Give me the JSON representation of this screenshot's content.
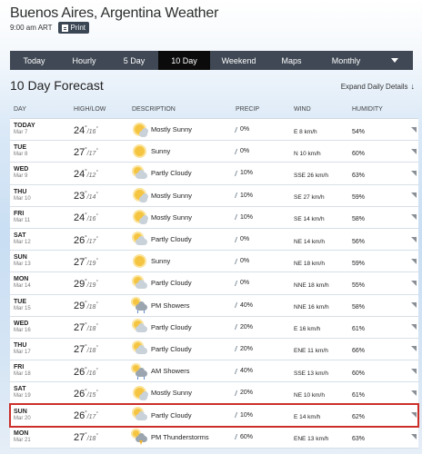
{
  "header": {
    "title": "Buenos Aires, Argentina Weather",
    "timestamp": "9:00 am ART",
    "print_label": "Print"
  },
  "tabs": [
    {
      "label": "Today"
    },
    {
      "label": "Hourly"
    },
    {
      "label": "5 Day"
    },
    {
      "label": "10 Day"
    },
    {
      "label": "Weekend"
    },
    {
      "label": "Maps"
    },
    {
      "label": "Monthly"
    }
  ],
  "section": {
    "title": "10 Day Forecast",
    "expand_label": "Expand Daily Details",
    "expand_arrow": "↓"
  },
  "columns": {
    "day": "DAY",
    "highlow": "HIGH/LOW",
    "description": "DESCRIPTION",
    "precip": "PRECIP",
    "wind": "WIND",
    "humidity": "HUMIDITY"
  },
  "rows": [
    {
      "day": "TODAY",
      "date": "Mar 7",
      "high": "24",
      "low": "16",
      "icon": "mostly-sunny",
      "desc": "Mostly Sunny",
      "precip": "0%",
      "wind": "E 8 km/h",
      "humidity": "54%"
    },
    {
      "day": "TUE",
      "date": "Mar 8",
      "high": "27",
      "low": "17",
      "icon": "sunny",
      "desc": "Sunny",
      "precip": "0%",
      "wind": "N 10 km/h",
      "humidity": "60%"
    },
    {
      "day": "WED",
      "date": "Mar 9",
      "high": "24",
      "low": "12",
      "icon": "partly-cloudy",
      "desc": "Partly Cloudy",
      "precip": "10%",
      "wind": "SSE 26 km/h",
      "humidity": "63%"
    },
    {
      "day": "THU",
      "date": "Mar 10",
      "high": "23",
      "low": "14",
      "icon": "mostly-sunny",
      "desc": "Mostly Sunny",
      "precip": "10%",
      "wind": "SE 27 km/h",
      "humidity": "59%"
    },
    {
      "day": "FRI",
      "date": "Mar 11",
      "high": "24",
      "low": "16",
      "icon": "mostly-sunny",
      "desc": "Mostly Sunny",
      "precip": "10%",
      "wind": "SE 14 km/h",
      "humidity": "58%"
    },
    {
      "day": "SAT",
      "date": "Mar 12",
      "high": "26",
      "low": "17",
      "icon": "partly-cloudy",
      "desc": "Partly Cloudy",
      "precip": "0%",
      "wind": "NE 14 km/h",
      "humidity": "56%"
    },
    {
      "day": "SUN",
      "date": "Mar 13",
      "high": "27",
      "low": "19",
      "icon": "sunny",
      "desc": "Sunny",
      "precip": "0%",
      "wind": "NE 18 km/h",
      "humidity": "59%"
    },
    {
      "day": "MON",
      "date": "Mar 14",
      "high": "29",
      "low": "19",
      "icon": "partly-cloudy",
      "desc": "Partly Cloudy",
      "precip": "0%",
      "wind": "NNE 18 km/h",
      "humidity": "55%"
    },
    {
      "day": "TUE",
      "date": "Mar 15",
      "high": "29",
      "low": "18",
      "icon": "pm-showers",
      "desc": "PM Showers",
      "precip": "40%",
      "wind": "NNE 16 km/h",
      "humidity": "58%"
    },
    {
      "day": "WED",
      "date": "Mar 16",
      "high": "27",
      "low": "18",
      "icon": "partly-cloudy",
      "desc": "Partly Cloudy",
      "precip": "20%",
      "wind": "E 16 km/h",
      "humidity": "61%"
    },
    {
      "day": "THU",
      "date": "Mar 17",
      "high": "27",
      "low": "18",
      "icon": "partly-cloudy",
      "desc": "Partly Cloudy",
      "precip": "20%",
      "wind": "ENE 11 km/h",
      "humidity": "66%"
    },
    {
      "day": "FRI",
      "date": "Mar 18",
      "high": "26",
      "low": "16",
      "icon": "am-showers",
      "desc": "AM Showers",
      "precip": "40%",
      "wind": "SSE 13 km/h",
      "humidity": "60%"
    },
    {
      "day": "SAT",
      "date": "Mar 19",
      "high": "26",
      "low": "15",
      "icon": "mostly-sunny",
      "desc": "Mostly Sunny",
      "precip": "20%",
      "wind": "NE 10 km/h",
      "humidity": "61%"
    },
    {
      "day": "SUN",
      "date": "Mar 20",
      "high": "26",
      "low": "17",
      "icon": "partly-cloudy",
      "desc": "Partly Cloudy",
      "precip": "10%",
      "wind": "E 14 km/h",
      "humidity": "62%",
      "highlight": true
    },
    {
      "day": "MON",
      "date": "Mar 21",
      "high": "27",
      "low": "18",
      "icon": "pm-thunderstorms",
      "desc": "PM Thunderstorms",
      "precip": "60%",
      "wind": "ENE 13 km/h",
      "humidity": "63%"
    }
  ],
  "colors": {
    "tabbar": "#3f4854",
    "tab_active": "#0b0b0b",
    "highlight_border": "#cc2f2a",
    "sun": "#f5c542"
  }
}
